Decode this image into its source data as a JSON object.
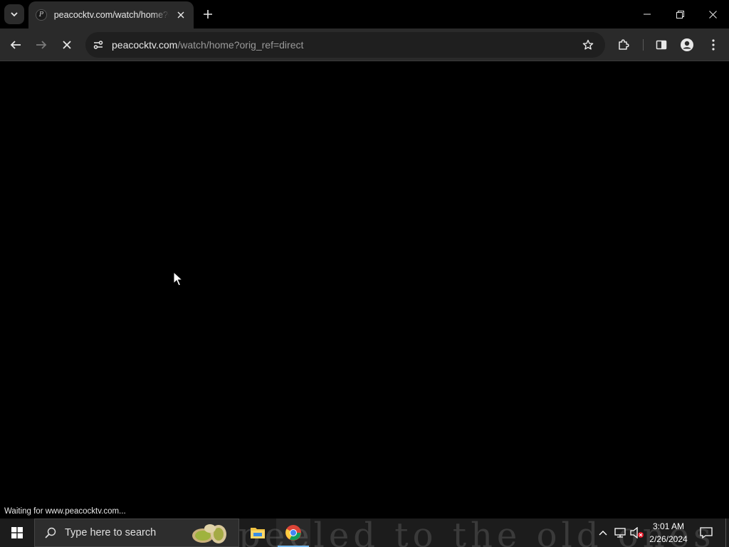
{
  "browser": {
    "tab": {
      "title": "peacocktv.com/watch/home?orig_ref=direct",
      "favicon_letter": "P"
    },
    "address_bar": {
      "host": "peacocktv.com",
      "rest": "/watch/home?orig_ref=direct"
    },
    "status_text": "Waiting for www.peacocktv.com..."
  },
  "taskbar": {
    "search_placeholder": "Type here to search",
    "clock_time": "3:01 AM",
    "clock_date": "2/26/2024",
    "wallpaper_text": "peeled to the old ones"
  },
  "colors": {
    "accent": "#76b9ed",
    "chrome_frame": "#000000",
    "toolbar": "#2a2a2a",
    "omnibox": "#1f1f1f",
    "taskbar": "#1c1c1c"
  },
  "icons": [
    "tab-search-icon",
    "favicon-icon",
    "close-icon",
    "plus-icon",
    "minimize-icon",
    "restore-icon",
    "window-close-icon",
    "back-arrow-icon",
    "forward-arrow-icon",
    "stop-loading-icon",
    "site-info-icon",
    "star-icon",
    "extensions-icon",
    "side-panel-icon",
    "profile-icon",
    "menu-dots-icon",
    "windows-logo-icon",
    "search-icon",
    "file-explorer-icon",
    "chrome-icon",
    "chevron-up-icon",
    "network-icon",
    "volume-muted-icon",
    "notification-icon"
  ]
}
